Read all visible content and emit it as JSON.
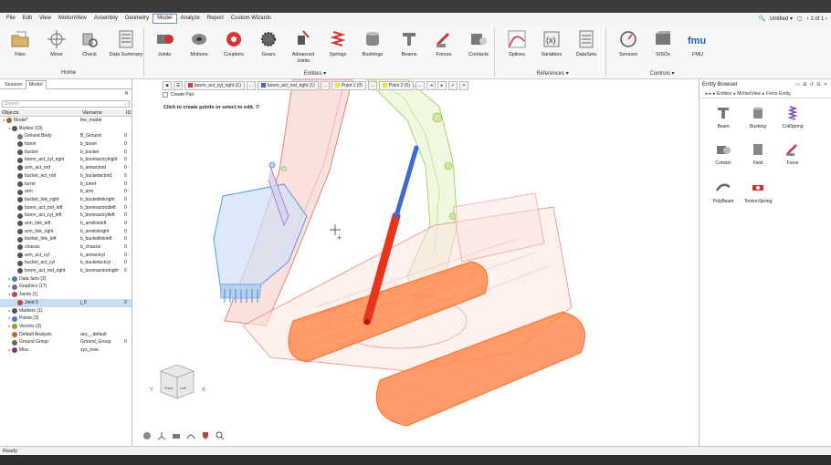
{
  "menu": {
    "items": [
      "File",
      "Edit",
      "View",
      "MotionView",
      "Assembly",
      "Geometry",
      "Model",
      "Analyze",
      "Report",
      "Custom Wizards"
    ],
    "active": "Model",
    "right": {
      "doc": "Untitled",
      "page": "1 of 1"
    }
  },
  "ribbon": {
    "home": [
      {
        "name": "files",
        "label": "Files"
      },
      {
        "name": "move",
        "label": "Move"
      },
      {
        "name": "check",
        "label": "Check"
      },
      {
        "name": "data-summary",
        "label": "Data Summary"
      }
    ],
    "entities": [
      {
        "name": "joints",
        "label": "Joints"
      },
      {
        "name": "motions",
        "label": "Motions"
      },
      {
        "name": "couplers",
        "label": "Couplers"
      },
      {
        "name": "gears",
        "label": "Gears"
      },
      {
        "name": "advanced-joints",
        "label": "Advanced Joints"
      },
      {
        "name": "springs",
        "label": "Springs"
      },
      {
        "name": "bushings",
        "label": "Bushings"
      },
      {
        "name": "beams",
        "label": "Beams"
      },
      {
        "name": "forces",
        "label": "Forces"
      },
      {
        "name": "contacts",
        "label": "Contacts"
      }
    ],
    "references": [
      {
        "name": "splines",
        "label": "Splines"
      },
      {
        "name": "variables",
        "label": "Variables"
      },
      {
        "name": "datasets",
        "label": "DataSets"
      }
    ],
    "controls": [
      {
        "name": "sensors",
        "label": "Sensors"
      },
      {
        "name": "sisos",
        "label": "SISOs"
      },
      {
        "name": "fmu",
        "label": "FMU"
      }
    ],
    "groups": {
      "home": "Home",
      "entities": "Entities",
      "references": "References",
      "controls": "Controls"
    }
  },
  "left_panel": {
    "tabs": [
      "Session",
      "Model"
    ],
    "active_tab": "Model",
    "search_placeholder": "Search",
    "columns": [
      "Objects",
      "Varname",
      "ID"
    ],
    "rows": [
      {
        "indent": 0,
        "tw": "▾",
        "icon": "#8a6d3b",
        "obj": "Model*",
        "var": "the_model",
        "id": ""
      },
      {
        "indent": 1,
        "tw": "▾",
        "icon": "#555",
        "obj": "Bodies (19)",
        "var": "",
        "id": ""
      },
      {
        "indent": 2,
        "tw": "",
        "icon": "#777",
        "obj": "Ground Body",
        "var": "B_Ground",
        "id": "0"
      },
      {
        "indent": 2,
        "tw": "",
        "icon": "#555",
        "obj": "boom",
        "var": "b_boom",
        "id": "0"
      },
      {
        "indent": 2,
        "tw": "",
        "icon": "#555",
        "obj": "bucket",
        "var": "b_bucket",
        "id": "0"
      },
      {
        "indent": 2,
        "tw": "",
        "icon": "#555",
        "obj": "boom_act_cyl_right",
        "var": "b_boomactcylright",
        "id": "0"
      },
      {
        "indent": 2,
        "tw": "",
        "icon": "#555",
        "obj": "arm_act_rod",
        "var": "b_armactrod",
        "id": "0"
      },
      {
        "indent": 2,
        "tw": "",
        "icon": "#555",
        "obj": "bucket_act_rod",
        "var": "b_bucketactrod",
        "id": "0"
      },
      {
        "indent": 2,
        "tw": "",
        "icon": "#555",
        "obj": "turret",
        "var": "b_turret",
        "id": "0"
      },
      {
        "indent": 2,
        "tw": "",
        "icon": "#555",
        "obj": "arm",
        "var": "b_arm",
        "id": "0"
      },
      {
        "indent": 2,
        "tw": "",
        "icon": "#555",
        "obj": "bucket_link_right",
        "var": "b_bucketlinkright",
        "id": "0"
      },
      {
        "indent": 2,
        "tw": "",
        "icon": "#555",
        "obj": "boom_act_rod_left",
        "var": "b_boomactrodleft",
        "id": "0"
      },
      {
        "indent": 2,
        "tw": "",
        "icon": "#555",
        "obj": "boom_act_cyl_left",
        "var": "b_boomactcylleft",
        "id": "0"
      },
      {
        "indent": 2,
        "tw": "",
        "icon": "#555",
        "obj": "arm_link_left",
        "var": "b_armlinkleft",
        "id": "0"
      },
      {
        "indent": 2,
        "tw": "",
        "icon": "#555",
        "obj": "arm_link_right",
        "var": "b_armlinkright",
        "id": "0"
      },
      {
        "indent": 2,
        "tw": "",
        "icon": "#555",
        "obj": "bucket_link_left",
        "var": "b_bucketlinkleft",
        "id": "0"
      },
      {
        "indent": 2,
        "tw": "",
        "icon": "#555",
        "obj": "chassis",
        "var": "b_chassis",
        "id": "0"
      },
      {
        "indent": 2,
        "tw": "",
        "icon": "#555",
        "obj": "arm_act_cyl",
        "var": "b_armactcyl",
        "id": "0"
      },
      {
        "indent": 2,
        "tw": "",
        "icon": "#555",
        "obj": "bucket_act_cyl",
        "var": "b_bucketactcyl",
        "id": "0"
      },
      {
        "indent": 2,
        "tw": "",
        "icon": "#555",
        "obj": "boom_act_rod_right",
        "var": "b_boomactrodright",
        "id": "0"
      },
      {
        "indent": 1,
        "tw": "▸",
        "icon": "#4a7bb7",
        "obj": "Data Sets (2)",
        "var": "",
        "id": ""
      },
      {
        "indent": 1,
        "tw": "▸",
        "icon": "#6d6d9a",
        "obj": "Graphics (17)",
        "var": "",
        "id": ""
      },
      {
        "indent": 1,
        "tw": "▾",
        "icon": "#b44",
        "obj": "Joints (1)",
        "var": "",
        "id": ""
      },
      {
        "indent": 2,
        "tw": "",
        "icon": "#b44",
        "obj": "Joint 0",
        "var": "j_0",
        "id": "0",
        "sel": true
      },
      {
        "indent": 1,
        "tw": "▸",
        "icon": "#555",
        "obj": "Markers (1)",
        "var": "",
        "id": ""
      },
      {
        "indent": 1,
        "tw": "▸",
        "icon": "#4a7bb7",
        "obj": "Points (3)",
        "var": "",
        "id": ""
      },
      {
        "indent": 1,
        "tw": "▸",
        "icon": "#b88a2a",
        "obj": "Vectors (3)",
        "var": "",
        "id": ""
      },
      {
        "indent": 1,
        "tw": "",
        "icon": "#c06a2a",
        "obj": "Default Analysis",
        "var": "anc__default",
        "id": ""
      },
      {
        "indent": 1,
        "tw": "",
        "icon": "#666",
        "obj": "Ground Group",
        "var": "Ground_Group",
        "id": "0"
      },
      {
        "indent": 1,
        "tw": "▸",
        "icon": "#8a3b3b",
        "obj": "Misc",
        "var": "sys_misc",
        "id": ""
      }
    ]
  },
  "viewport": {
    "toolbar": [
      {
        "name": "joint-body1",
        "label": "boom_act_cyl_right (1)",
        "color": "#d23a3a"
      },
      {
        "name": "joint-body2",
        "label": "boom_act_rod_right (1)",
        "color": "#3a6ad2"
      },
      {
        "name": "joint-point1",
        "label": "Point 1 (0)",
        "color": "#f0e030"
      },
      {
        "name": "joint-point2",
        "label": "Point 2 (0)",
        "color": "#f0e030"
      }
    ],
    "create_pair": "Create Pair",
    "hint": "Click to create points or select to edit.",
    "axes": {
      "x": "X",
      "y": "Y"
    }
  },
  "right_panel": {
    "title": "Entity Browser",
    "breadcrumb": [
      "Entities",
      "MotionView",
      "Force Entity"
    ],
    "entities": [
      {
        "name": "beam",
        "label": "Beam"
      },
      {
        "name": "bushing",
        "label": "Bushing"
      },
      {
        "name": "coilspring",
        "label": "CoilSpring"
      },
      {
        "name": "contact",
        "label": "Contact"
      },
      {
        "name": "field",
        "label": "Field"
      },
      {
        "name": "force",
        "label": "Force"
      },
      {
        "name": "polybeam",
        "label": "PolyBeam"
      },
      {
        "name": "torsionspring",
        "label": "TorsionSpring"
      }
    ]
  },
  "status": "Ready",
  "colors": {
    "accent": "#3a6ad2",
    "bucket": "#4a8ee0",
    "boom": "#e26a5a",
    "arm": "#9fd04a",
    "track": "#ff6a2a",
    "chassis": "#f08a7a"
  }
}
